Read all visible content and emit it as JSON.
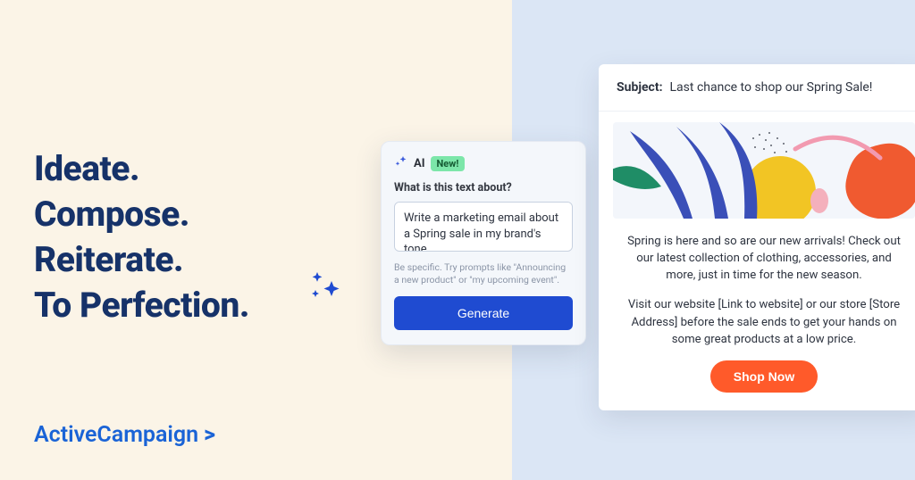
{
  "headline": {
    "line1": "Ideate.",
    "line2": "Compose.",
    "line3": "Reiterate.",
    "line4": "To Perfection."
  },
  "brand": {
    "name": "ActiveCampaign",
    "arrow": ">"
  },
  "ai_card": {
    "label": "AI",
    "badge": "New!",
    "question": "What is this text about?",
    "textarea_value": "Write a marketing email about a Spring sale in my brand's tone",
    "hint": "Be specific. Try prompts like \"Announcing a new product\" or \"my upcoming event\".",
    "generate_label": "Generate"
  },
  "email": {
    "subject_label": "Subject:",
    "subject_value": "Last chance to shop our Spring Sale!",
    "para1": "Spring is here and so are our new arrivals! Check out our latest collection of clothing, accessories, and more, just in time for the new season.",
    "para2": "Visit our website [Link to website] or our store [Store Address] before the sale ends to get your hands on some great products at a low price.",
    "cta_label": "Shop Now"
  }
}
